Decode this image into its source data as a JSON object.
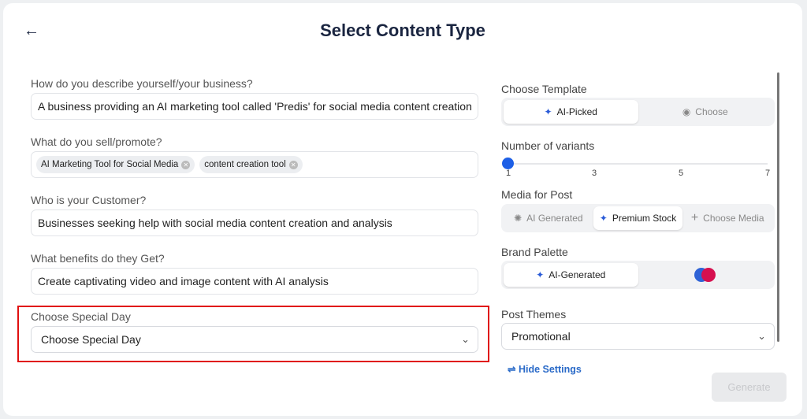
{
  "header": {
    "title": "Select Content Type",
    "back_icon": "arrow-left-icon"
  },
  "form": {
    "describe": {
      "label": "How do you describe yourself/your business?",
      "value": "A business providing an AI marketing tool called 'Predis' for social media content creation"
    },
    "sell": {
      "label": "What do you sell/promote?",
      "tags": [
        "AI Marketing Tool for Social Media",
        "content creation tool"
      ]
    },
    "customer": {
      "label": "Who is your Customer?",
      "value": "Businesses seeking help with social media content creation and analysis"
    },
    "benefits": {
      "label": "What benefits do they Get?",
      "value": "Create captivating video and image content with AI analysis"
    },
    "special_day": {
      "label": "Choose Special Day",
      "value": "Choose Special Day"
    }
  },
  "settings": {
    "template": {
      "label": "Choose Template",
      "options": [
        "AI-Picked",
        "Choose"
      ],
      "selected": "AI-Picked"
    },
    "variants": {
      "label": "Number of variants",
      "ticks": [
        "1",
        "3",
        "5",
        "7"
      ],
      "value": 1
    },
    "media": {
      "label": "Media for Post",
      "options": [
        "AI Generated",
        "Premium Stock",
        "Choose Media"
      ],
      "selected": "Premium Stock"
    },
    "palette": {
      "label": "Brand Palette",
      "options": [
        "AI-Generated"
      ],
      "selected": "AI-Generated",
      "swatch_colors": [
        "#2f63d6",
        "#d6104f"
      ]
    },
    "themes": {
      "label": "Post Themes",
      "value": "Promotional"
    },
    "hide_settings": "Hide Settings",
    "generate": "Generate"
  },
  "colors": {
    "accent": "#1d5fe6",
    "highlight": "#e01010"
  }
}
